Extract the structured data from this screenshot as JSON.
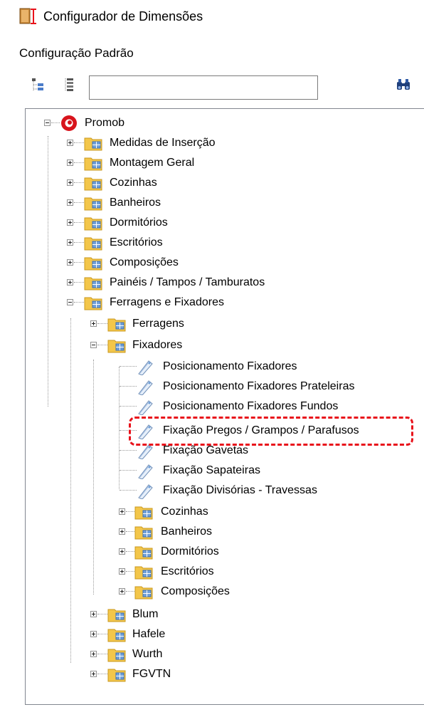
{
  "window": {
    "title": "Configurador de Dimensões"
  },
  "section": {
    "label": "Configuração Padrão"
  },
  "toolbar": {
    "search": {
      "value": "",
      "placeholder": ""
    }
  },
  "tree": {
    "root": "Promob",
    "level1": [
      "Medidas de Inserção",
      "Montagem Geral",
      "Cozinhas",
      "Banheiros",
      "Dormitórios",
      "Escritórios",
      "Composições",
      "Painéis / Tampos / Tamburatos",
      "Ferragens e Fixadores"
    ],
    "ferragens_children": [
      "Ferragens",
      "Fixadores",
      "Blum",
      "Hafele",
      "Wurth",
      "FGVTN"
    ],
    "fixadores_items": [
      "Posicionamento Fixadores",
      "Posicionamento Fixadores Prateleiras",
      "Posicionamento Fixadores Fundos",
      "Fixação Pregos / Grampos / Parafusos",
      "Fixação Gavetas",
      "Fixação Sapateiras",
      "Fixação Divisórias - Travessas"
    ],
    "fixadores_folders": [
      "Cozinhas",
      "Banheiros",
      "Dormitórios",
      "Escritórios",
      "Composições"
    ]
  },
  "colors": {
    "highlight": "#e8121b",
    "folder": "#f3c64a",
    "doc_icon": "#6f9fd8"
  }
}
